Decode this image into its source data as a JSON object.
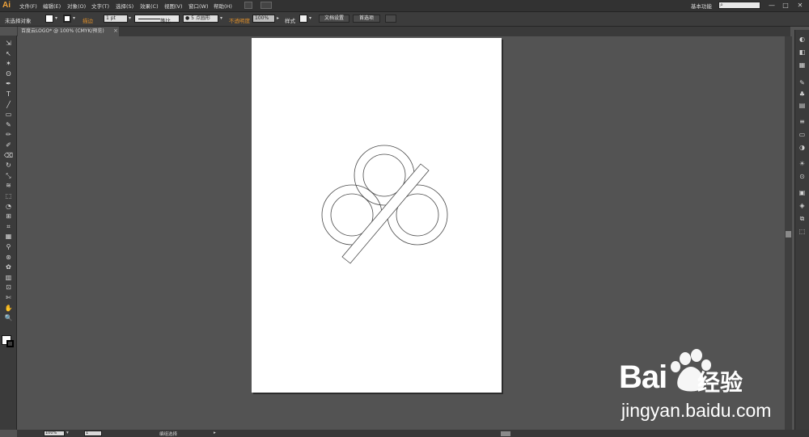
{
  "app": {
    "logo": "Ai"
  },
  "menubar": {
    "items": [
      "文件(F)",
      "编辑(E)",
      "对象(O)",
      "文字(T)",
      "选择(S)",
      "效果(C)",
      "视图(V)",
      "窗口(W)",
      "帮助(H)"
    ],
    "workspace": "基本功能",
    "window_controls": [
      "—",
      "□",
      "✕"
    ]
  },
  "controlbar": {
    "selection_status": "未选择对象",
    "stroke_label": "描边",
    "stroke_weight": "1 pt",
    "stroke_profile": "等比",
    "brush": "● 5 点圆形",
    "opacity_label": "不透明度",
    "opacity_value": "100%",
    "style_label": "样式",
    "doc_setup_button": "文档设置",
    "preferences_button": "首选项"
  },
  "document": {
    "tab_title": "百度云LOGO* @ 100% (CMYK/预览)",
    "close_glyph": "×"
  },
  "statusbar": {
    "zoom": "100%",
    "artboard_number": "1",
    "status_text": "编组选择"
  },
  "tools": {
    "icons": [
      "selection-arrow-icon",
      "direct-selection-icon",
      "magic-wand-icon",
      "lasso-icon",
      "pen-icon",
      "type-icon",
      "line-segment-icon",
      "rectangle-icon",
      "paintbrush-icon",
      "pencil-icon",
      "blob-brush-icon",
      "eraser-icon",
      "rotate-icon",
      "scale-icon",
      "warp-icon",
      "free-transform-icon",
      "shape-builder-icon",
      "perspective-grid-icon",
      "mesh-icon",
      "gradient-icon",
      "eyedropper-icon",
      "blend-icon",
      "symbol-sprayer-icon",
      "column-graph-icon",
      "artboard-icon",
      "slice-icon",
      "hand-icon",
      "zoom-icon"
    ],
    "glyphs": [
      "⇲",
      "↖",
      "✶",
      "ʘ",
      "✒",
      "T",
      "╱",
      "▭",
      "✎",
      "✏",
      "✐",
      "⌫",
      "↻",
      "⤡",
      "≋",
      "⬚",
      "◔",
      "⊞",
      "⌗",
      "▦",
      "⚲",
      "⊛",
      "✿",
      "▥",
      "⊡",
      "✄",
      "✋",
      "🔍"
    ]
  },
  "rightpanel": {
    "icons": [
      "color-icon",
      "color-guide-icon",
      "swatches-icon",
      "brushes-icon",
      "symbols-icon",
      "graphic-styles-icon",
      "stroke-icon",
      "gradient-panel-icon",
      "transparency-icon",
      "appearance-icon",
      "layers-icon",
      "artboards-icon",
      "align-icon",
      "pathfinder-icon",
      "transform-icon"
    ],
    "glyphs": [
      "◐",
      "◧",
      "▦",
      "✎",
      "♣",
      "▤",
      "≡",
      "▭",
      "◑",
      "☀",
      "⊙",
      "▣",
      "◈",
      "⧉",
      "⬚"
    ]
  },
  "watermark": {
    "brand_left": "Bai",
    "brand_right": "经验",
    "url": "jingyan.baidu.com"
  },
  "colors": {
    "accent_orange": "#e0902a",
    "canvas": "#535353",
    "artboard": "#ffffff",
    "path_stroke": "#4a4a4a"
  }
}
